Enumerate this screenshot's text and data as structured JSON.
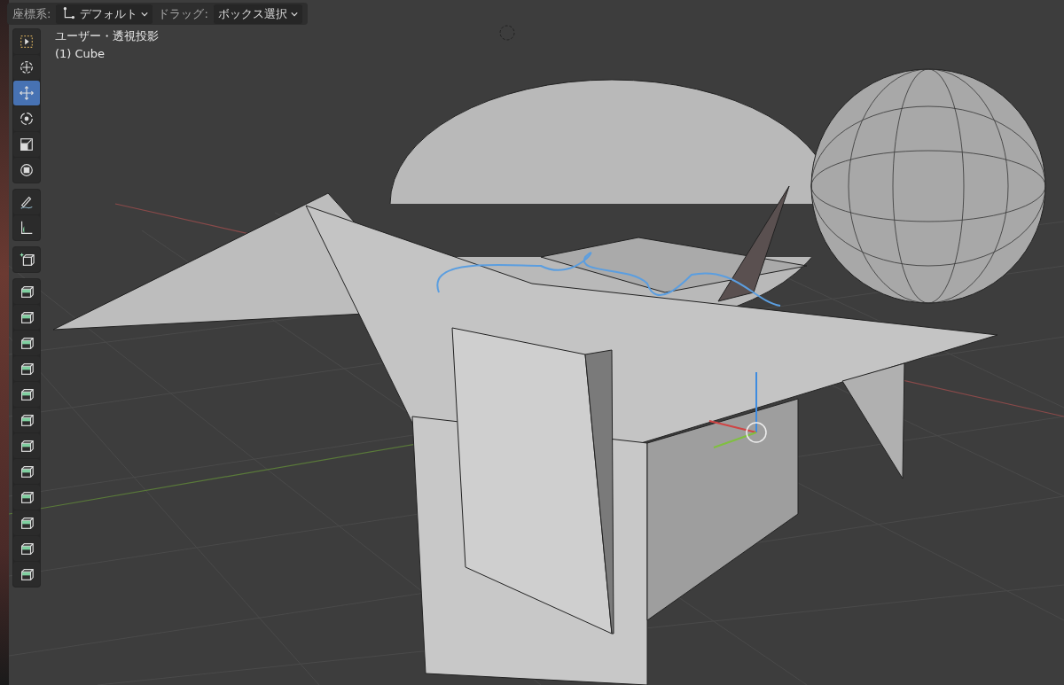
{
  "header": {
    "fields": [
      {
        "label": "座標系:",
        "value": "デフォルト",
        "kind": "orientation"
      },
      {
        "label": "ドラッグ:",
        "value": "ボックス選択",
        "kind": "plain"
      }
    ]
  },
  "viewport": {
    "view_name": "ユーザー・透視投影",
    "object": "(1) Cube"
  },
  "toolbar": {
    "groups": [
      [
        {
          "kind": "select",
          "selected": false
        },
        {
          "kind": "cursor",
          "selected": false
        },
        {
          "kind": "move",
          "selected": true
        },
        {
          "kind": "rotate",
          "selected": false
        },
        {
          "kind": "scale",
          "selected": false
        },
        {
          "kind": "transform",
          "selected": false
        }
      ],
      [
        {
          "kind": "annotate",
          "selected": false
        },
        {
          "kind": "measure",
          "selected": false
        }
      ],
      [
        {
          "kind": "add",
          "selected": false
        }
      ],
      [
        {
          "kind": "extrude",
          "selected": false
        },
        {
          "kind": "inset",
          "selected": false
        },
        {
          "kind": "bevel",
          "selected": false
        },
        {
          "kind": "loopcut",
          "selected": false
        },
        {
          "kind": "knife",
          "selected": false
        },
        {
          "kind": "polybuild",
          "selected": false
        },
        {
          "kind": "spin",
          "selected": false
        },
        {
          "kind": "smooth",
          "selected": false
        },
        {
          "kind": "slide",
          "selected": false
        },
        {
          "kind": "shrink",
          "selected": false
        },
        {
          "kind": "shear",
          "selected": false
        },
        {
          "kind": "rip",
          "selected": false
        }
      ]
    ]
  }
}
